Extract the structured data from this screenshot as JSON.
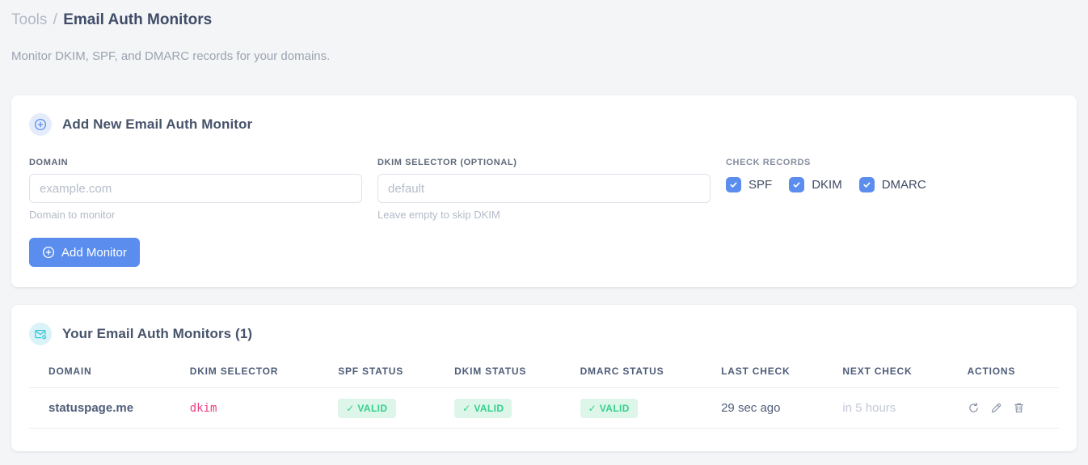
{
  "breadcrumb": {
    "parent": "Tools",
    "separator": "/",
    "current": "Email Auth Monitors"
  },
  "subtitle": "Monitor DKIM, SPF, and DMARC records for your domains.",
  "add_monitor_card": {
    "title": "Add New Email Auth Monitor",
    "fields": {
      "domain": {
        "label": "DOMAIN",
        "value": "",
        "placeholder": "example.com",
        "helper": "Domain to monitor"
      },
      "dkim_selector": {
        "label": "DKIM SELECTOR (OPTIONAL)",
        "value": "",
        "placeholder": "default",
        "helper": "Leave empty to skip DKIM"
      }
    },
    "check_records": {
      "label": "CHECK RECORDS",
      "options": [
        {
          "label": "SPF",
          "checked": true
        },
        {
          "label": "DKIM",
          "checked": true
        },
        {
          "label": "DMARC",
          "checked": true
        }
      ]
    },
    "submit_label": "Add Monitor"
  },
  "monitors_card": {
    "title": "Your Email Auth Monitors (1)",
    "count": 1,
    "table": {
      "columns": [
        "DOMAIN",
        "DKIM SELECTOR",
        "SPF STATUS",
        "DKIM STATUS",
        "DMARC STATUS",
        "LAST CHECK",
        "NEXT CHECK",
        "ACTIONS"
      ],
      "rows": [
        {
          "domain": "statuspage.me",
          "dkim_selector": "dkim",
          "spf_status": "✓ VALID",
          "dkim_status": "✓ VALID",
          "dmarc_status": "✓ VALID",
          "last_check": "29 sec ago",
          "next_check": "in 5 hours",
          "actions": [
            "refresh",
            "edit",
            "delete"
          ]
        }
      ]
    }
  },
  "colors": {
    "accent_blue": "#5a8dee",
    "success_text": "#35d08c",
    "success_bg": "#ddf6e9",
    "selector_pink": "#ee3d84",
    "icon_teal": "#35c5d8",
    "heading": "#3f4d68",
    "page_bg": "#f4f5f7"
  }
}
